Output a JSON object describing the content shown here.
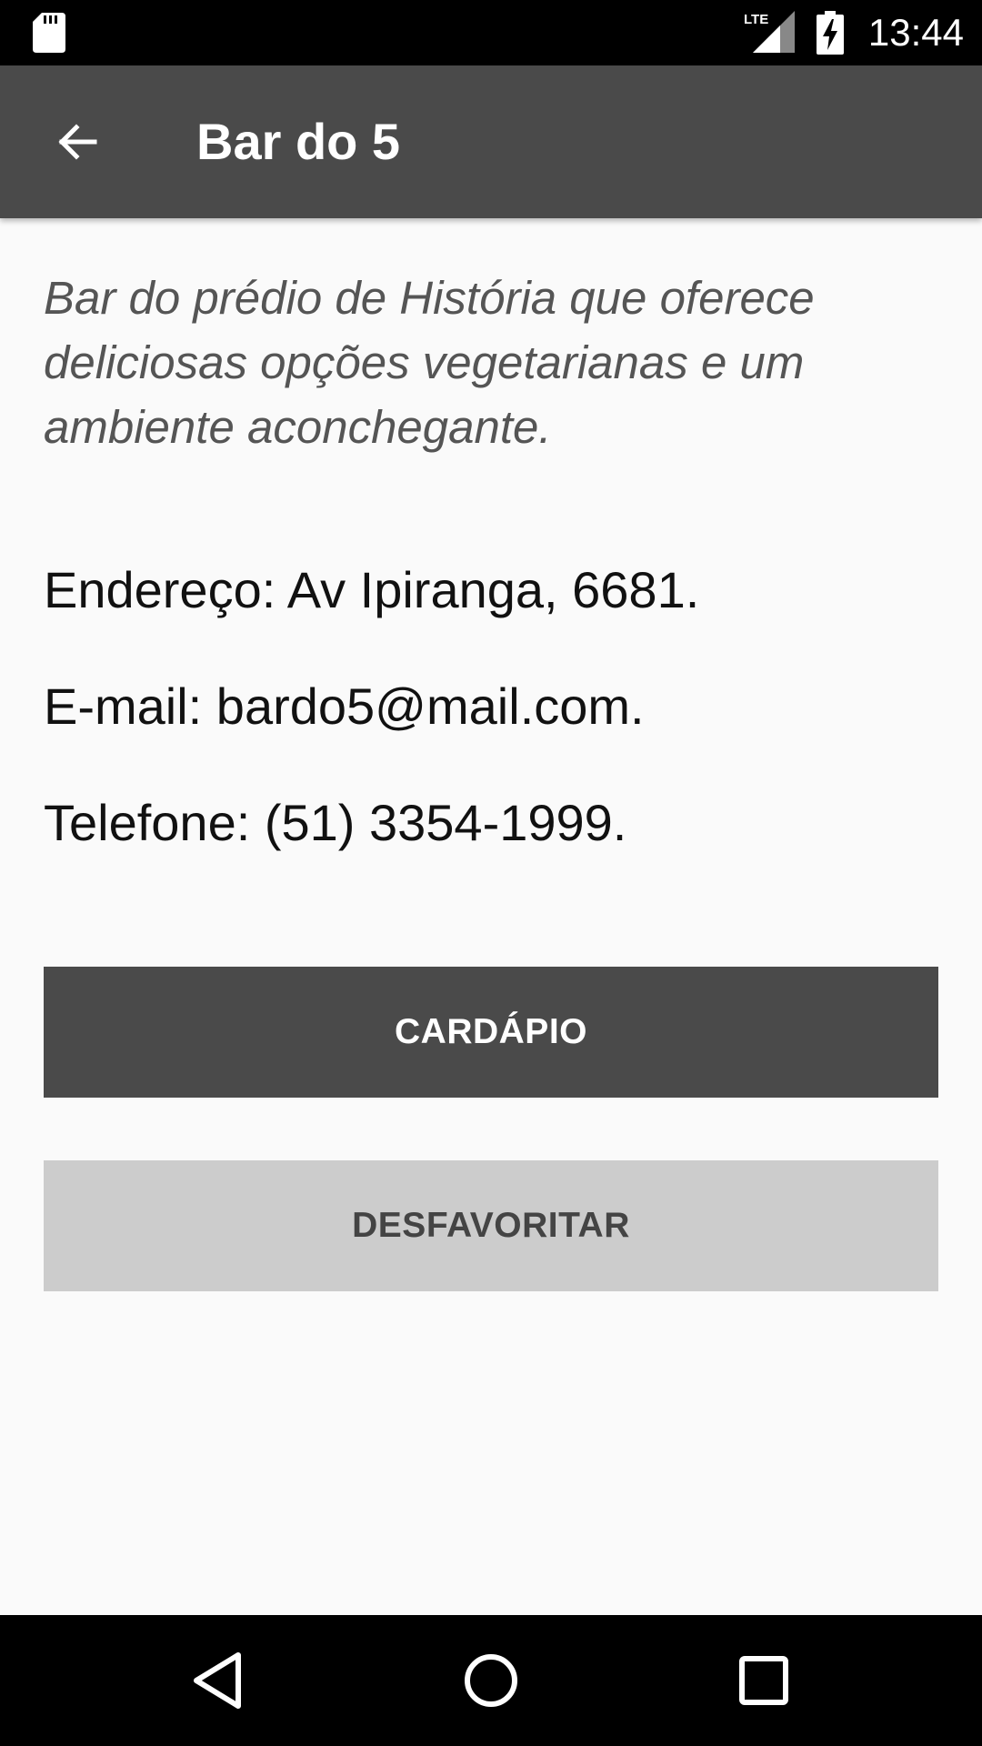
{
  "status_bar": {
    "network_label": "LTE",
    "time": "13:44",
    "icons": [
      "sd-card-icon",
      "lte-signal-icon",
      "battery-charging-icon"
    ]
  },
  "app_bar": {
    "back_icon": "arrow-back-icon",
    "title": "Bar do 5",
    "background": "#4a4a4a"
  },
  "details": {
    "description": "Bar do prédio de História que oferece deliciosas opções vegetarianas e um ambiente aconchegante.",
    "address": "Endereço: Av Ipiranga, 6681.",
    "email": "E-mail: bardo5@mail.com.",
    "phone": "Telefone: (51) 3354-1999."
  },
  "actions": {
    "menu_label": "CARDÁPIO",
    "unfavorite_label": "DESFAVORITAR",
    "menu_color": "#4a4a4a",
    "unfavorite_color": "#cccccc"
  },
  "nav_bar": {
    "icons": [
      "nav-back-icon",
      "nav-home-icon",
      "nav-recents-icon"
    ]
  }
}
